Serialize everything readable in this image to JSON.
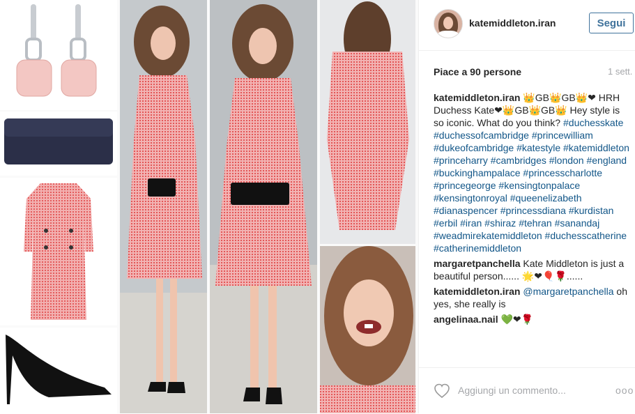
{
  "post": {
    "username": "katemiddleton.iran",
    "follow_label": "Segui",
    "likes_text": "Piace a 90 persone",
    "time_ago": "1 sett."
  },
  "caption": {
    "user": "katemiddleton.iran",
    "text": " 👑GB👑GB👑❤ HRH Duchess Kate❤👑GB👑GB👑 Hey style is so iconic. What do you think?",
    "hashtags": [
      "#duchesskate",
      "#duchessofcambridge",
      "#princewilliam",
      "#dukeofcambridge",
      "#katestyle",
      "#katemiddleton",
      "#princeharry",
      "#cambridges",
      "#london",
      "#england",
      "#buckinghampalace",
      "#princesscharlotte",
      "#princegeorge",
      "#kensingtonpalace",
      "#kensingtonroyal",
      "#queenelizabeth",
      "#dianaspencer",
      "#princessdiana",
      "#kurdistan",
      "#erbil",
      "#iran",
      "#shiraz",
      "#tehran",
      "#sanandaj",
      "#weadmirekatemiddleton",
      "#duchesscatherine",
      "#catherinemiddleton"
    ]
  },
  "comments": [
    {
      "user": "margaretpanchella",
      "mention": "",
      "text": " Kate Middleton is just a beautiful person...... 🌟❤🎈🌹......"
    },
    {
      "user": "katemiddleton.iran",
      "mention": "@margaretpanchella",
      "text": " oh yes, she really is"
    },
    {
      "user": "angelinaa.nail",
      "mention": "",
      "text": " 💚❤🌹"
    }
  ],
  "footer": {
    "add_comment_placeholder": "Aggiungi un commento...",
    "more_label": "ooo"
  },
  "images": [
    {
      "name": "pink-earrings-photo",
      "color": "#f4c6c6"
    },
    {
      "name": "navy-clutch-photo",
      "color": "#2b2f48"
    },
    {
      "name": "pink-dress-photo",
      "color": "#e86a6a"
    },
    {
      "name": "black-pumps-photo",
      "color": "#111111"
    },
    {
      "name": "kate-walking-left-photo",
      "color": "#e86a6a"
    },
    {
      "name": "kate-walking-front-photo",
      "color": "#e86a6a"
    },
    {
      "name": "kate-back-photo",
      "color": "#e86a6a"
    },
    {
      "name": "kate-smiling-photo",
      "color": "#8a5b3e"
    }
  ]
}
